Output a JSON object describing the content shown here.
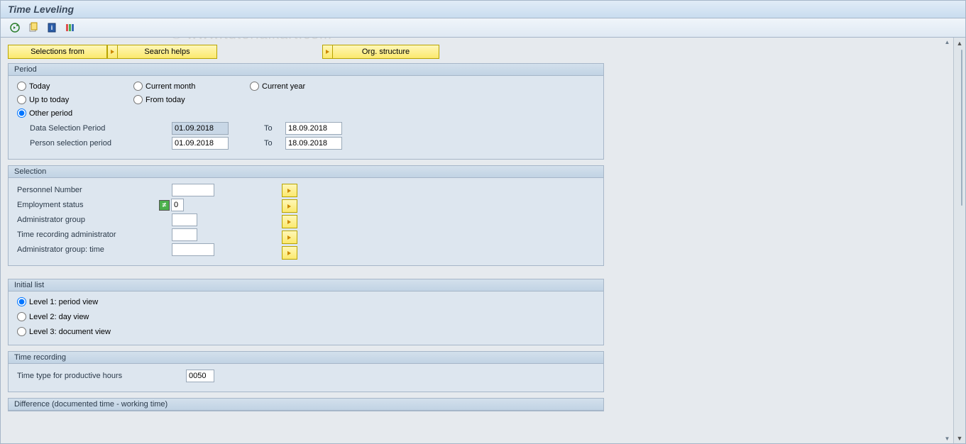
{
  "title": "Time Leveling",
  "watermark": "© www.tutorialkart.com",
  "toolbar_buttons": {
    "selections_from": "Selections from",
    "search_helps": "Search helps",
    "org_structure": "Org. structure"
  },
  "period": {
    "title": "Period",
    "radios": {
      "today": "Today",
      "current_month": "Current month",
      "current_year": "Current year",
      "up_to_today": "Up to today",
      "from_today": "From today",
      "other_period": "Other period"
    },
    "selected": "other_period",
    "fields": {
      "data_selection_label": "Data Selection Period",
      "data_selection_from": "01.09.2018",
      "data_selection_to": "18.09.2018",
      "person_selection_label": "Person selection period",
      "person_selection_from": "01.09.2018",
      "person_selection_to": "18.09.2018",
      "to_label": "To"
    }
  },
  "selection": {
    "title": "Selection",
    "rows": {
      "personnel_number": "Personnel Number",
      "employment_status": "Employment status",
      "employment_status_val": "0",
      "admin_group": "Administrator group",
      "time_rec_admin": "Time recording administrator",
      "admin_group_time": "Administrator group: time"
    }
  },
  "initial_list": {
    "title": "Initial list",
    "radios": {
      "level1": "Level 1: period view",
      "level2": "Level 2: day view",
      "level3": "Level 3: document view"
    },
    "selected": "level1"
  },
  "time_recording": {
    "title": "Time recording",
    "label": "Time type for productive hours",
    "value": "0050"
  },
  "difference": {
    "title": "Difference (documented time - working time)"
  }
}
